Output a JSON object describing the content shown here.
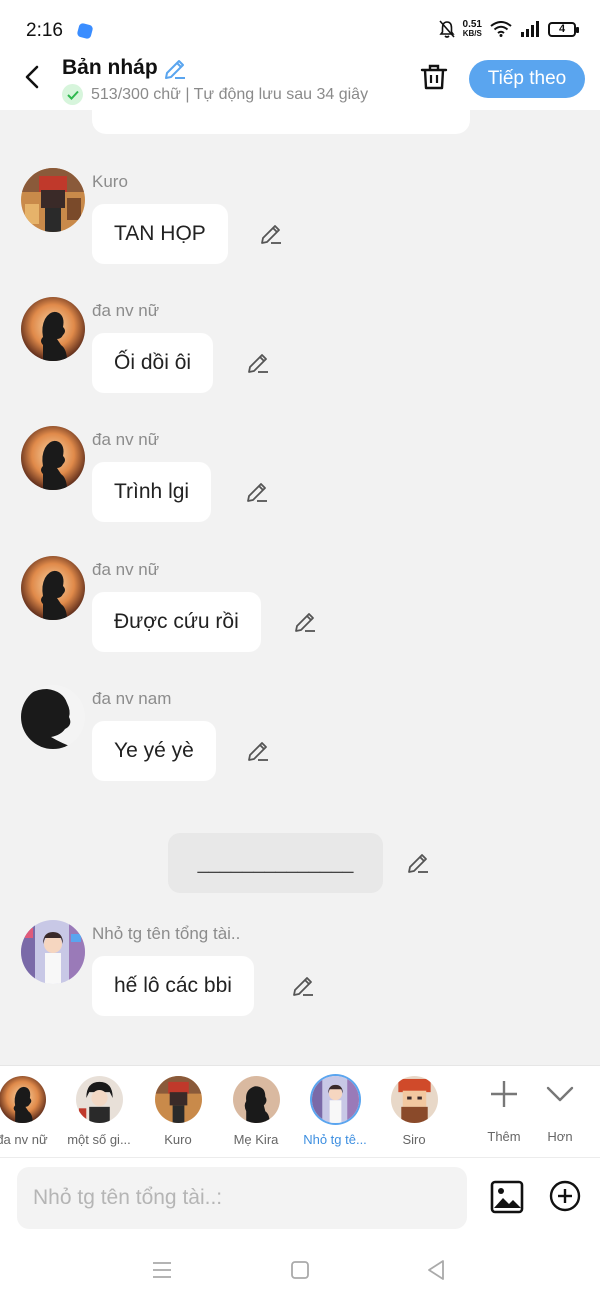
{
  "status": {
    "time": "2:16",
    "speed_value": "0.51",
    "speed_unit": "KB/S",
    "battery": "4"
  },
  "header": {
    "title": "Bản nháp",
    "subtitle": "513/300 chữ | Tự động lưu sau 34 giây",
    "next_label": "Tiếp theo"
  },
  "messages": [
    {
      "sender": "Kuro",
      "text": "TAN HỌP"
    },
    {
      "sender": "đa nv nữ",
      "text": "Ối dồi ôi"
    },
    {
      "sender": "đa nv nữ",
      "text": "Trình lgi"
    },
    {
      "sender": "đa nv nữ",
      "text": "Được cứu rồi"
    },
    {
      "sender": "đa nv nam",
      "text": "Ye yé yè"
    },
    {
      "sender": "Nhỏ tg tên tổng tài..",
      "text": "hế lô các bbi"
    }
  ],
  "divider_text": "______________",
  "characters": [
    {
      "name": "đa nv nữ"
    },
    {
      "name": "một số gi..."
    },
    {
      "name": "Kuro"
    },
    {
      "name": "Mẹ Kira"
    },
    {
      "name": "Nhỏ tg tê...",
      "active": true
    },
    {
      "name": "Siro"
    }
  ],
  "tools": {
    "add_label": "Thêm",
    "more_label": "Hơn"
  },
  "input": {
    "placeholder": "Nhỏ tg tên tổng tài..:"
  },
  "colors": {
    "accent": "#5aa5ef",
    "background": "#f2f2f2"
  },
  "icons": [
    "back-arrow-icon",
    "edit-pencil-icon",
    "check-icon",
    "trash-icon",
    "image-icon",
    "add-circle-icon",
    "plus-icon",
    "chevron-down-icon",
    "menu-icon",
    "home-square-icon",
    "back-triangle-icon"
  ]
}
